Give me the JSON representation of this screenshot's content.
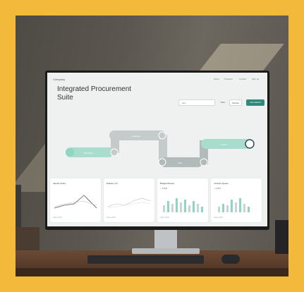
{
  "screen": {
    "brand": "Company",
    "nav": [
      "About",
      "Products",
      "Contact",
      "Sign up"
    ],
    "title": "Integrated Procurement Suite",
    "select_value": "Item",
    "button_1": "Filter",
    "button_2": "Module",
    "button_primary": "Get started",
    "flow_steps": [
      "Purchase",
      "Approval",
      "Buy",
      "Invoice"
    ],
    "cards": [
      {
        "title": "Vendor Score",
        "footer": "Last month"
      },
      {
        "title": "Delivery Ch.",
        "footer": "Last month"
      },
      {
        "title": "Budget Review",
        "value": "~ 4,823",
        "footer": "Last month"
      },
      {
        "title": "Invoices Queue",
        "value": "~ 4,827",
        "footer": "Last month"
      }
    ]
  },
  "colors": {
    "frame": "#f2b93b",
    "accent": "#2e8b7a",
    "flow_green": "#8fd6c2",
    "flow_grey": "#b9c2c0"
  }
}
